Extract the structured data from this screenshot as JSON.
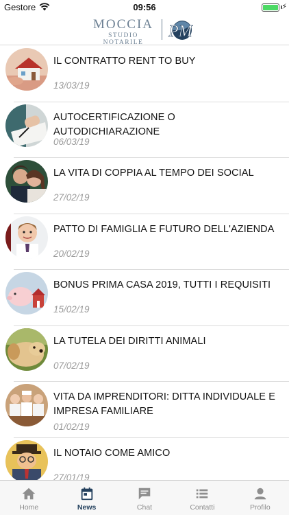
{
  "status_bar": {
    "carrier": "Gestore",
    "time": "09:56",
    "battery_level": 1.0
  },
  "header": {
    "logo_name": "MOCCIA",
    "logo_subtitle": "STUDIO NOTARILE",
    "logo_mark": "PM",
    "brand_color": "#24415e"
  },
  "news": [
    {
      "title": "IL CONTRATTO RENT TO BUY",
      "date": "13/03/19",
      "thumb_icon": "house-keys-photo"
    },
    {
      "title": "AUTOCERTIFICAZIONE O AUTODICHIARAZIONE",
      "date": "06/03/19",
      "thumb_icon": "signing-document-photo"
    },
    {
      "title": "LA VITA DI COPPIA AL TEMPO DEI SOCIAL",
      "date": "27/02/19",
      "thumb_icon": "couple-photo"
    },
    {
      "title": "PATTO DI FAMIGLIA E FUTURO DELL'AZIENDA",
      "date": "20/02/19",
      "thumb_icon": "child-photo"
    },
    {
      "title": "BONUS PRIMA CASA 2019, TUTTI I REQUISITI",
      "date": "15/02/19",
      "thumb_icon": "piggy-bank-house-photo"
    },
    {
      "title": "LA TUTELA DEI DIRITTI ANIMALI",
      "date": "07/02/19",
      "thumb_icon": "dog-photo"
    },
    {
      "title": "VITA DA IMPRENDITORI: DITTA INDIVIDUALE E IMPRESA FAMILIARE",
      "date": "01/02/19",
      "thumb_icon": "bakery-family-photo"
    },
    {
      "title": "IL NOTAIO COME AMICO",
      "date": "27/01/19",
      "thumb_icon": "notary-figurine-photo"
    }
  ],
  "tabs": [
    {
      "label": "Home",
      "icon": "home-icon",
      "active": false
    },
    {
      "label": "News",
      "icon": "calendar-icon",
      "active": true
    },
    {
      "label": "Chat",
      "icon": "chat-icon",
      "active": false
    },
    {
      "label": "Contatti",
      "icon": "list-icon",
      "active": false
    },
    {
      "label": "Profilo",
      "icon": "user-icon",
      "active": false
    }
  ],
  "colors": {
    "tab_active": "#24415e",
    "tab_inactive": "#8e8e8e",
    "date_text": "#9a9a9a"
  }
}
